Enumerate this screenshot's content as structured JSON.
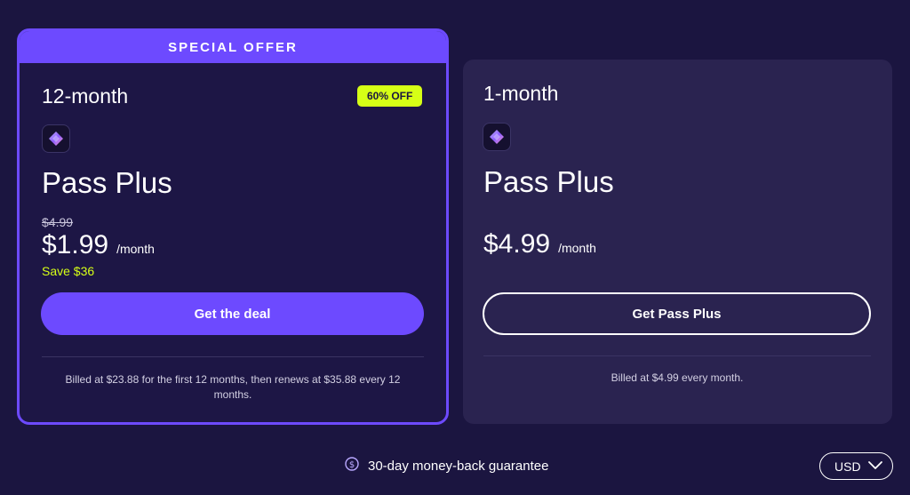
{
  "featured": {
    "banner": "SPECIAL OFFER",
    "period": "12-month",
    "badge": "60% OFF",
    "plan": "Pass Plus",
    "old_price": "$4.99",
    "price": "$1.99",
    "per": "/month",
    "save": "Save $36",
    "cta": "Get the deal",
    "billing": "Billed at $23.88 for the first 12 months, then renews at $35.88 every 12 months."
  },
  "monthly": {
    "period": "1-month",
    "plan": "Pass Plus",
    "price": "$4.99",
    "per": "/month",
    "cta": "Get Pass Plus",
    "billing": "Billed at $4.99 every month."
  },
  "footer": {
    "guarantee": "30-day money-back guarantee",
    "currency": "USD"
  },
  "colors": {
    "background": "#1b1540",
    "accent": "#6d4aff",
    "highlight": "#d6ff16",
    "card": "#2a2350"
  },
  "icons": [
    "pass-logo-icon",
    "dollar-circle-icon",
    "chevron-down-icon"
  ]
}
